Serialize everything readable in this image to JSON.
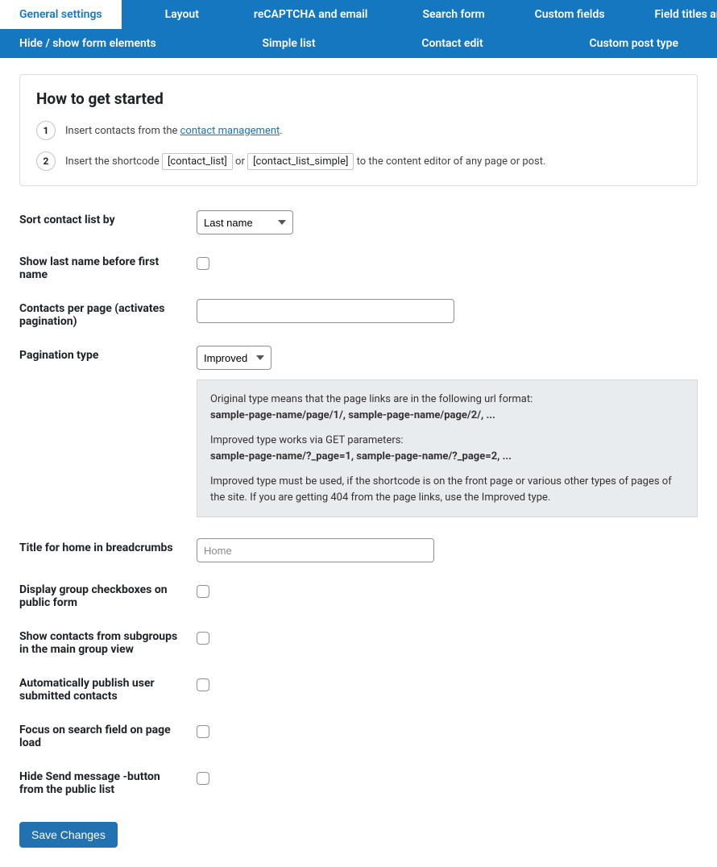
{
  "tabs": {
    "general": "General settings",
    "layout": "Layout",
    "recaptcha": "reCAPTCHA and email",
    "search": "Search form",
    "custom_fields": "Custom fields",
    "field_titles": "Field titles and texts",
    "hide_show": "Hide / show form elements",
    "simple_list": "Simple list",
    "contact_edit": "Contact edit",
    "custom_post": "Custom post type"
  },
  "intro": {
    "heading": "How to get started",
    "step1_num": "1",
    "step1_before": "Insert contacts from the ",
    "step1_link": "contact management",
    "step1_after": ".",
    "step2_num": "2",
    "step2_before": "Insert the shortcode ",
    "step2_chip1": "[contact_list]",
    "step2_or": " or ",
    "step2_chip2": "[contact_list_simple]",
    "step2_after": " to the content editor of any page or post."
  },
  "form": {
    "sort_label": "Sort contact list by",
    "sort_value": "Last name",
    "lastname_first_label": "Show last name before first name",
    "per_page_label": "Contacts per page (activates pagination)",
    "per_page_value": "",
    "pagination_label": "Pagination type",
    "pagination_value": "Improved",
    "bc_title_label": "Title for home in breadcrumbs",
    "bc_title_placeholder": "Home",
    "bc_title_value": "",
    "group_cb_label": "Display group checkboxes on public form",
    "subgroups_label": "Show contacts from subgroups in the main group view",
    "autopub_label": "Automatically publish user submitted contacts",
    "focus_label": "Focus on search field on page load",
    "hide_send_label": "Hide Send message -button from the public list"
  },
  "help": {
    "p1a": "Original type means that the page links are in the following url format:",
    "p1b": "sample-page-name/page/1/, sample-page-name/page/2/, ...",
    "p2a": "Improved type works via GET parameters:",
    "p2b": "sample-page-name/?_page=1, sample-page-name/?_page=2, ...",
    "p3": "Improved type must be used, if the shortcode is on the front page or various other types of pages of the site. If you are getting 404 from the page links, use the Improved type."
  },
  "save_label": "Save Changes"
}
